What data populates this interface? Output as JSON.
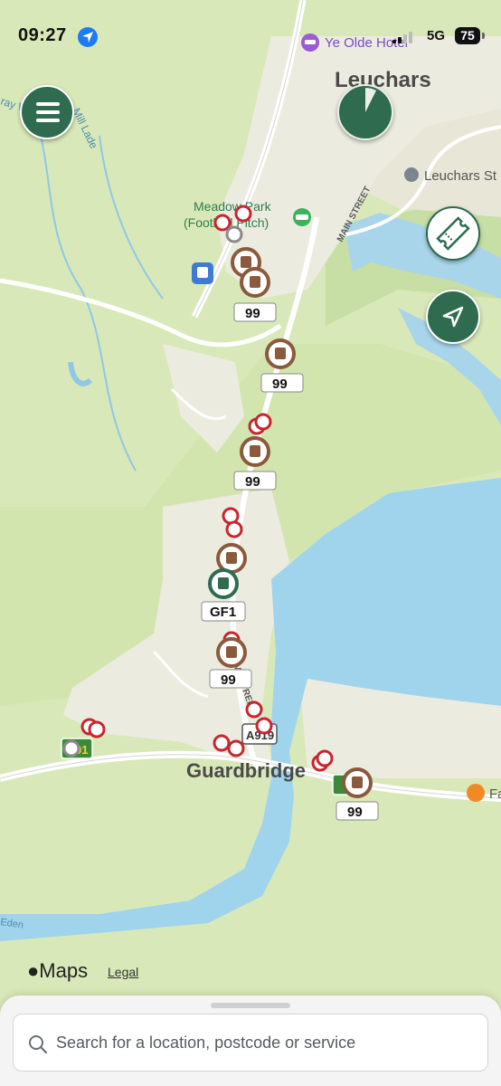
{
  "status_bar": {
    "time": "09:27",
    "network": "5G",
    "battery": "75"
  },
  "map": {
    "places": {
      "town": "Leuchars",
      "hotel": "Ye Olde Hotel",
      "park_line1": "Meadow Park",
      "park_line2": "(Football Pitch)",
      "village": "Guardbridge",
      "poi_leuchars_station": "Leuchars St",
      "poi_fa": "Fa"
    },
    "streets": {
      "main_street": "MAIN STREET",
      "water": "Mill Lade",
      "water2": "ray Water",
      "road_a919": "A919",
      "m_street": "M...STREET",
      "river_label": "Eden"
    },
    "route_labels": {
      "label_99": "99",
      "label_gf1": "GF1",
      "label_91": "91"
    },
    "attribution": {
      "brand": "Maps",
      "legal": "Legal"
    }
  },
  "colors": {
    "accent_green": "#2e6b4f",
    "bus_brown": "#8b5a3c",
    "stop_red": "#c8262f",
    "water": "#9fd4ec",
    "land": "#d9e8b8"
  },
  "search": {
    "placeholder": "Search for a location, postcode or service",
    "value": ""
  },
  "icons": {
    "menu": "hamburger-icon",
    "timer": "timer-icon",
    "ticket": "ticket-icon",
    "locate": "navigation-arrow-icon",
    "search": "search-icon",
    "location_services": "location-arrow-icon"
  }
}
